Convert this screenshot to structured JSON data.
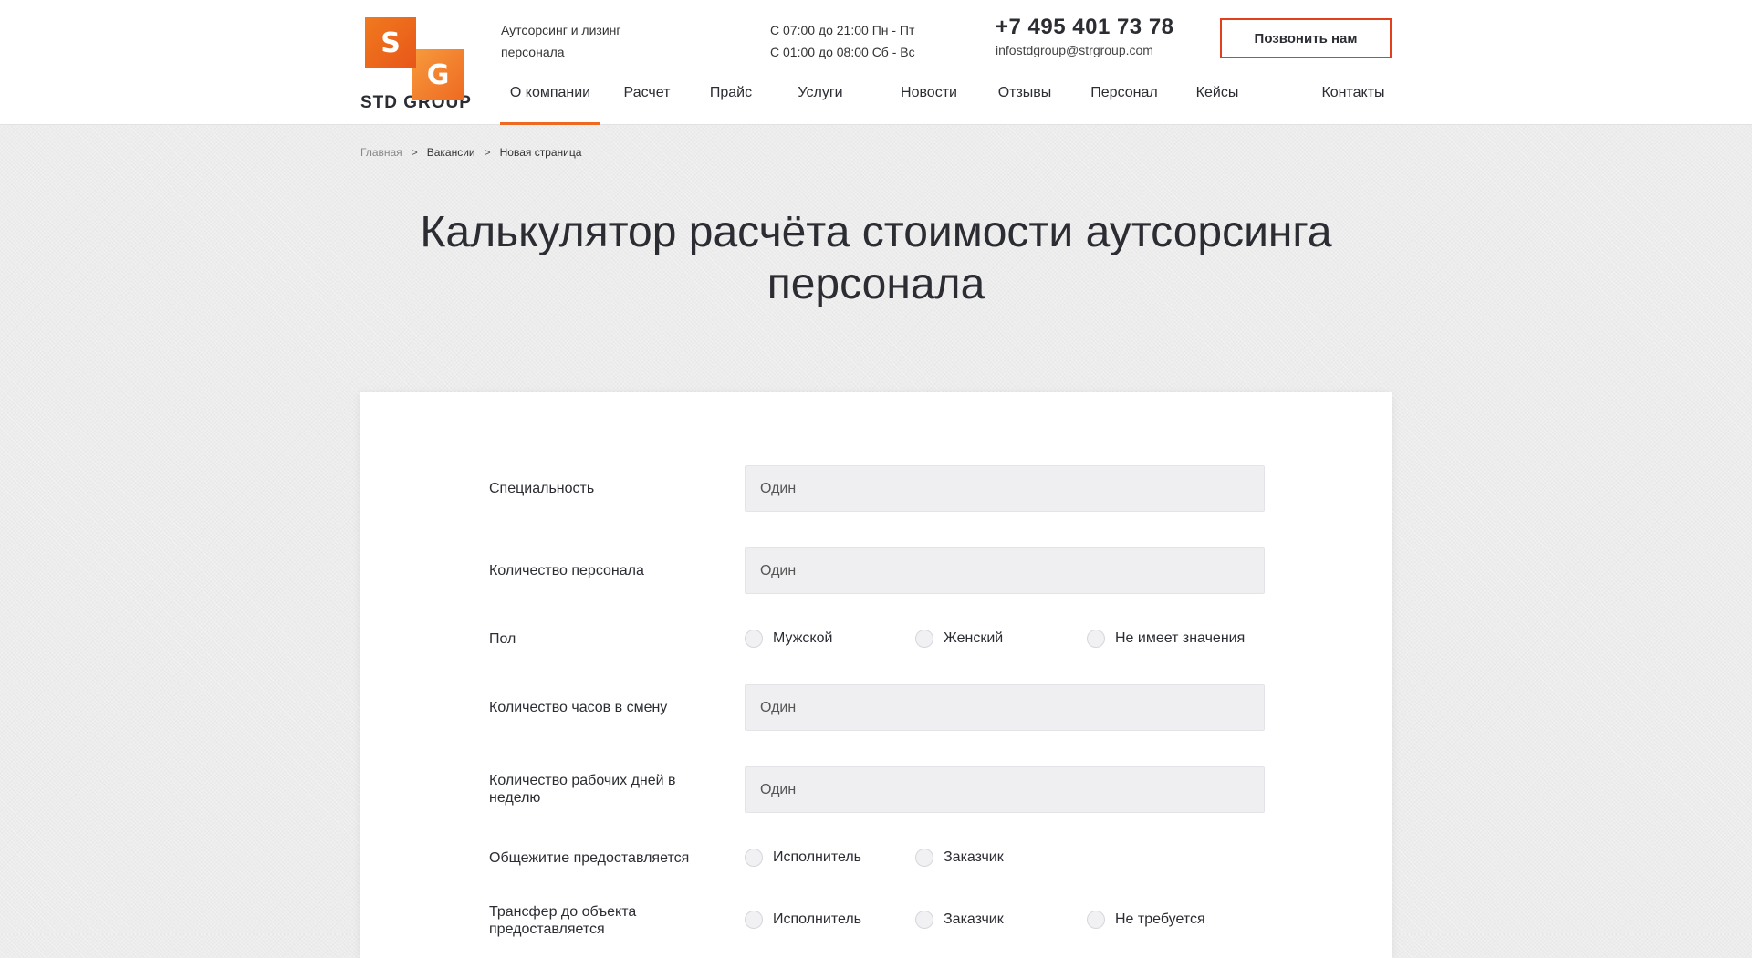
{
  "logo": {
    "letter1": "S",
    "letter2": "G",
    "brand": "STD GROUP"
  },
  "header": {
    "tagline": "Аутсорсинг и лизинг персонала",
    "hours_1": "С 07:00 до 21:00 Пн - Пт",
    "hours_2": "С 01:00 до 08:00 Сб - Вс",
    "phone": "+7 495 401 73 78",
    "email": "infostdgroup@strgroup.com",
    "call_label": "Позвонить нам"
  },
  "nav": {
    "items": [
      "О компании",
      "Расчет",
      "Прайс",
      "Услуги",
      "Новости",
      "Отзывы",
      "Персонал",
      "Кейсы",
      "Контакты"
    ],
    "active": "О компании"
  },
  "breadcrumb": {
    "home": "Главная",
    "sep": ">",
    "level1": "Вакансии",
    "current": "Новая страница"
  },
  "page": {
    "title": "Калькулятор расчёта стоимости аутсорсинга персонала"
  },
  "form": {
    "specialty": {
      "label": "Специальность",
      "placeholder": "Один"
    },
    "staff_count": {
      "label": "Количество персонала",
      "placeholder": "Один"
    },
    "gender": {
      "label": "Пол",
      "options": [
        "Мужской",
        "Женский",
        "Не имеет значения"
      ]
    },
    "hours_per_shift": {
      "label": "Количество часов в смену",
      "placeholder": "Один"
    },
    "work_days": {
      "label": "Количество рабочих дней в неделю",
      "placeholder": "Один"
    },
    "dormitory": {
      "label": "Общежитие предоставляется",
      "options": [
        "Исполнитель",
        "Заказчик"
      ]
    },
    "transfer": {
      "label": "Трансфер до объекта предоставляется",
      "options": [
        "Исполнитель",
        "Заказчик",
        "Не требуется"
      ]
    }
  },
  "colors": {
    "accent": "#ee6a22",
    "call_border": "#e2401d",
    "text": "#2b2d33"
  }
}
